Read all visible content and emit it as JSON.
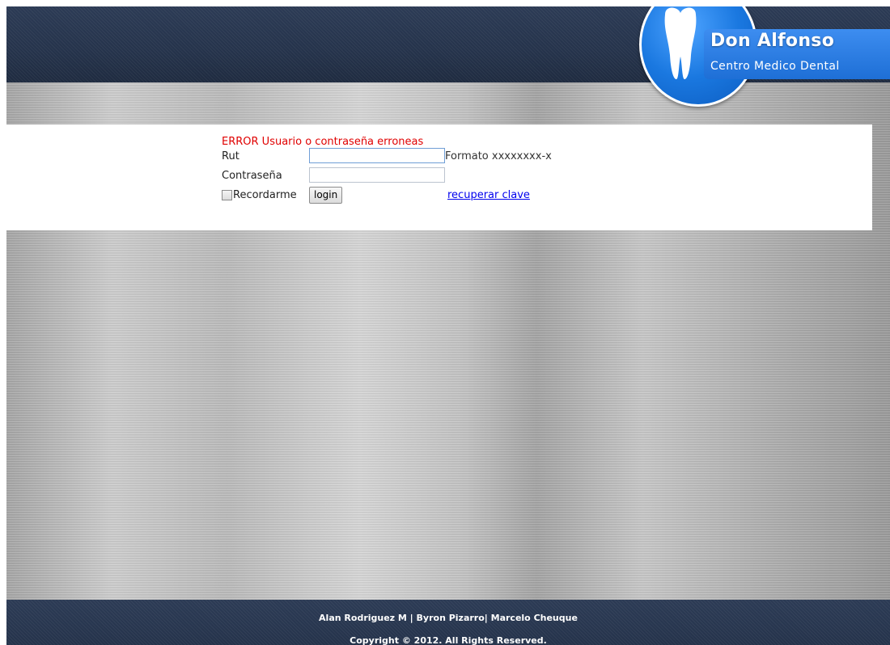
{
  "brand": {
    "title": "Don Alfonso",
    "subtitle": "Centro Medico Dental",
    "tooth_icon": "tooth-icon",
    "accent_color": "#1e6fd6",
    "header_color": "#25334b"
  },
  "login": {
    "error_message": "ERROR Usuario o contraseña erroneas",
    "error_color": "#e00000",
    "rut_label": "Rut",
    "rut_value": "",
    "rut_hint": "Formato xxxxxxxx-x",
    "password_label": "Contraseña",
    "password_value": "",
    "remember_label": "Recordarme",
    "remember_checked": false,
    "login_button": "login",
    "recover_link": "recuperar clave"
  },
  "footer": {
    "authors": "Alan Rodriguez M | Byron Pizarro| Marcelo Cheuque",
    "copyright": "Copyright © 2012. All Rights Reserved."
  }
}
